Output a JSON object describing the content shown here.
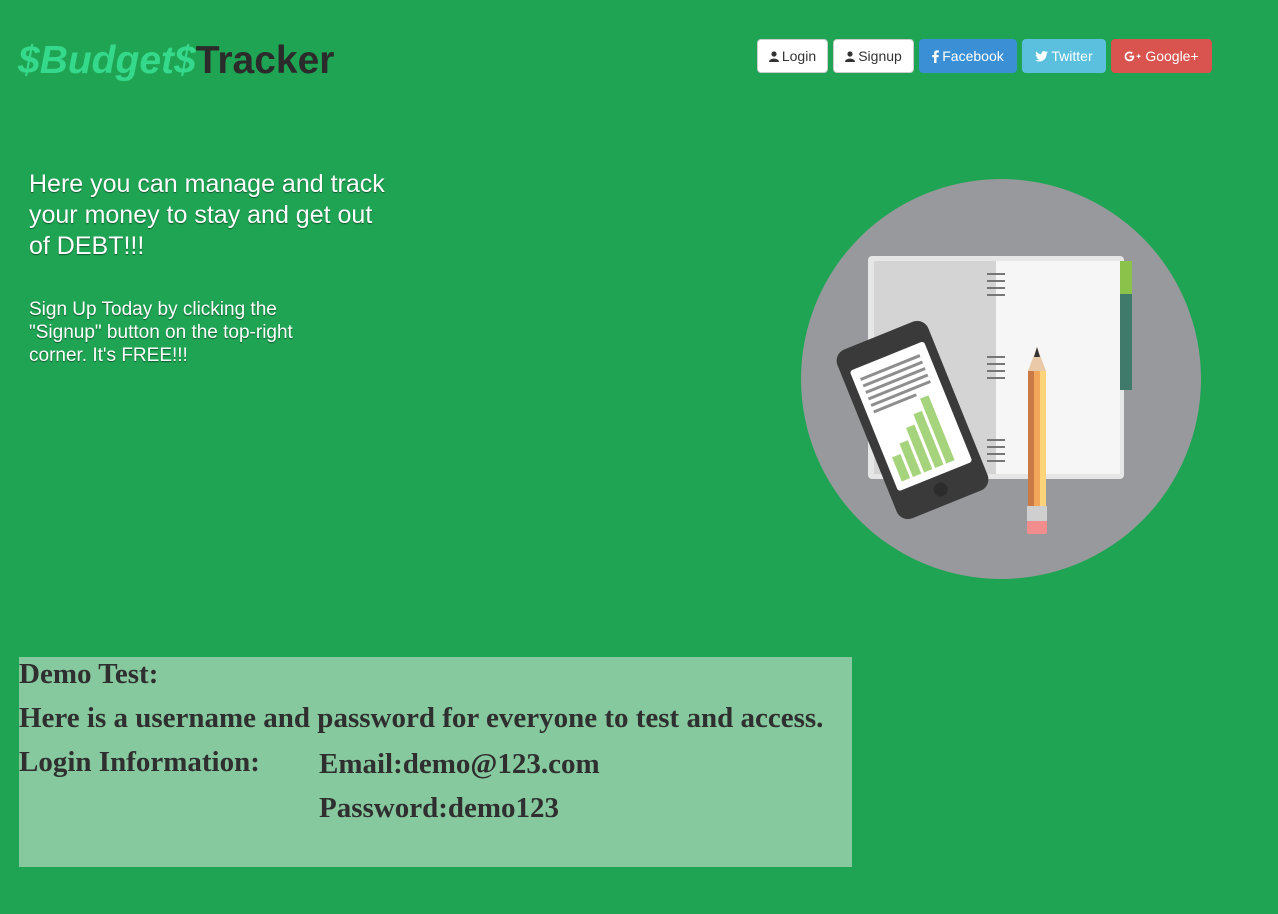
{
  "brand": {
    "accent": "$Budget$",
    "main": "Tracker"
  },
  "nav": {
    "login": "Login",
    "signup": "Signup",
    "facebook": "Facebook",
    "twitter": "Twitter",
    "google": "Google+"
  },
  "hero": {
    "headline": "Here you can manage and track your money to stay and get out of DEBT!!!",
    "subtext": "Sign Up Today by clicking the \"Signup\" button on the top-right corner. It's FREE!!!"
  },
  "demo": {
    "title": "Demo Test:",
    "description": "Here is a username and password for everyone to test and access.",
    "label": "Login Information:",
    "email": "Email:demo@123.com",
    "password": "Password:demo123"
  },
  "colors": {
    "background": "#1fa453",
    "brand_accent": "#35d98c",
    "facebook": "#3b8fd4",
    "twitter": "#5bc0de",
    "google": "#d9534f",
    "demo_panel": "#87c99e"
  }
}
